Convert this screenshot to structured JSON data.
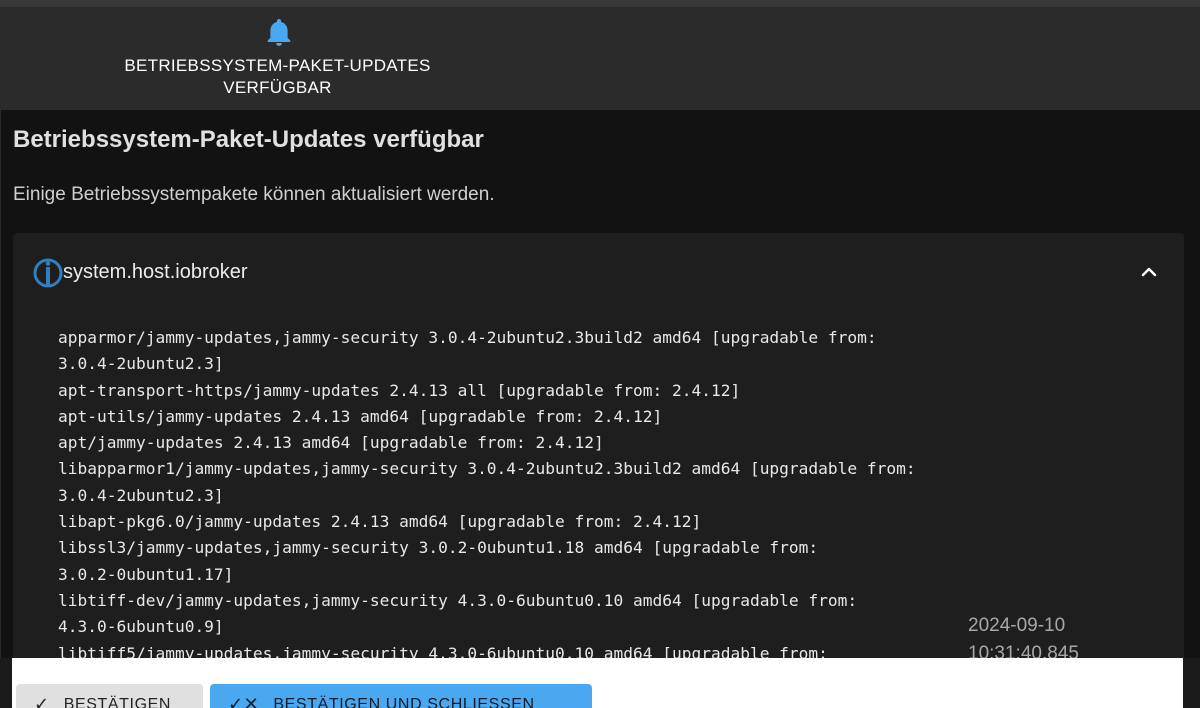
{
  "tab": {
    "label_line1": "BETRIEBSSYSTEM-PAKET-UPDATES",
    "label_line2": "VERFÜGBAR",
    "icon": "bell-icon",
    "accent": "#4aa8f0"
  },
  "dialog": {
    "title": "Betriebssystem-Paket-Updates verfügbar",
    "subtitle": "Einige Betriebssystempakete können aktualisiert werden."
  },
  "host": {
    "name": "system.host.iobroker",
    "icon": "iobroker-logo-icon",
    "toggle_icon": "chevron-up-icon"
  },
  "packages": [
    "apparmor/jammy-updates,jammy-security 3.0.4-2ubuntu2.3build2 amd64 [upgradable from:",
    "3.0.4-2ubuntu2.3]",
    "apt-transport-https/jammy-updates 2.4.13 all [upgradable from: 2.4.12]",
    "apt-utils/jammy-updates 2.4.13 amd64 [upgradable from: 2.4.12]",
    "apt/jammy-updates 2.4.13 amd64 [upgradable from: 2.4.12]",
    "libapparmor1/jammy-updates,jammy-security 3.0.4-2ubuntu2.3build2 amd64 [upgradable from:",
    "3.0.4-2ubuntu2.3]",
    "libapt-pkg6.0/jammy-updates 2.4.13 amd64 [upgradable from: 2.4.12]",
    "libssl3/jammy-updates,jammy-security 3.0.2-0ubuntu1.18 amd64 [upgradable from:",
    "3.0.2-0ubuntu1.17]",
    "libtiff-dev/jammy-updates,jammy-security 4.3.0-6ubuntu0.10 amd64 [upgradable from:",
    "4.3.0-6ubuntu0.9]",
    "libtiff5/jammy-updates,jammy-security 4.3.0-6ubuntu0.10 amd64 [upgradable from:"
  ],
  "timestamp": {
    "date": "2024-09-10",
    "time": "10:31:40.845"
  },
  "buttons": {
    "confirm": "BESTÄTIGEN",
    "confirm_close": "BESTÄTIGEN UND SCHLIESSEN"
  }
}
